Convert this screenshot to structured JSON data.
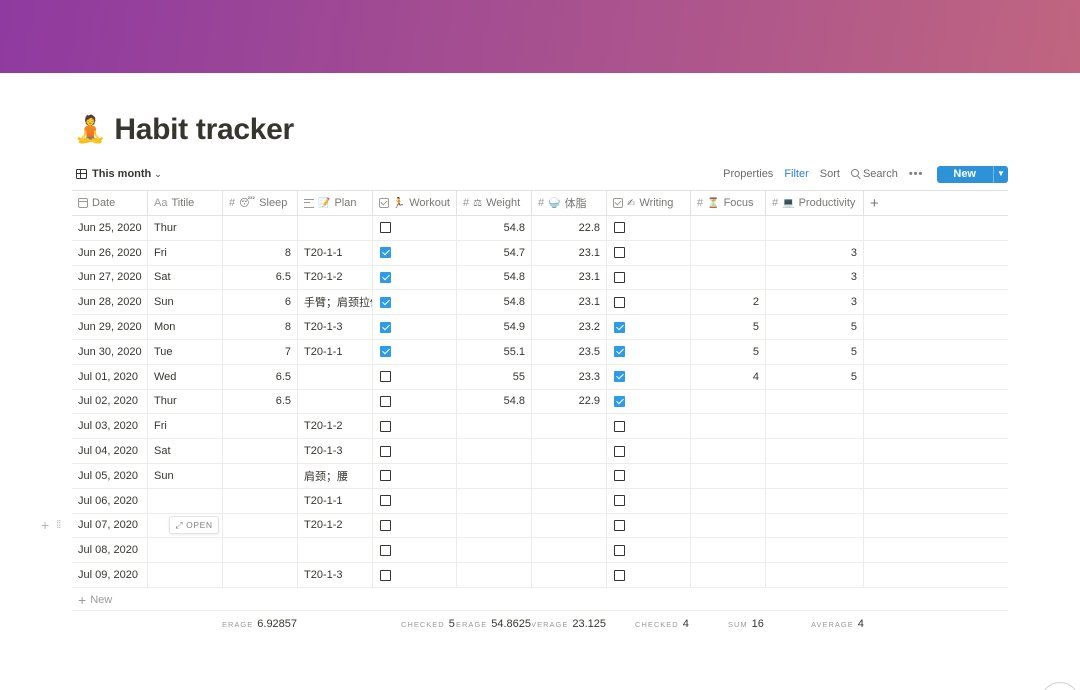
{
  "page": {
    "title_emoji": "🧘",
    "title": "Habit tracker",
    "cover_colors": [
      "#8f3aa0",
      "#c06580"
    ]
  },
  "toolbar": {
    "view_label": "This month",
    "properties": "Properties",
    "filter": "Filter",
    "sort": "Sort",
    "search": "Search",
    "more": "•••",
    "new": "New",
    "new_dropdown_icon": "chevron-down-icon"
  },
  "columns": [
    {
      "name": "Date",
      "icon": "calendar-icon"
    },
    {
      "name": "Titile",
      "icon": "Aa"
    },
    {
      "name": "Sleep",
      "icon": "#",
      "emoji": "😴"
    },
    {
      "name": "Plan",
      "icon": "text-lines-icon",
      "emoji": "📝"
    },
    {
      "name": "Workout",
      "icon": "checkbox-icon",
      "emoji": "🏃"
    },
    {
      "name": "Weight",
      "icon": "#",
      "emoji": "⚖"
    },
    {
      "name": "体脂",
      "icon": "#",
      "emoji": "🍚"
    },
    {
      "name": "Writing",
      "icon": "checkbox-icon",
      "emoji": "✍"
    },
    {
      "name": "Focus",
      "icon": "#",
      "emoji": "⏳"
    },
    {
      "name": "Productivity",
      "icon": "#",
      "emoji": "💻"
    }
  ],
  "rows": [
    {
      "date": "Jun 25, 2020",
      "title": "Thur",
      "sleep": "",
      "plan": "",
      "workout": false,
      "weight": "54.8",
      "fat": "22.8",
      "writing": false,
      "focus": "",
      "productivity": ""
    },
    {
      "date": "Jun 26, 2020",
      "title": "Fri",
      "sleep": "8",
      "plan": "T20-1-1",
      "workout": true,
      "weight": "54.7",
      "fat": "23.1",
      "writing": false,
      "focus": "",
      "productivity": "3"
    },
    {
      "date": "Jun 27, 2020",
      "title": "Sat",
      "sleep": "6.5",
      "plan": "T20-1-2",
      "workout": true,
      "weight": "54.8",
      "fat": "23.1",
      "writing": false,
      "focus": "",
      "productivity": "3"
    },
    {
      "date": "Jun 28, 2020",
      "title": "Sun",
      "sleep": "6",
      "plan": "手臂；肩颈拉伸",
      "workout": true,
      "weight": "54.8",
      "fat": "23.1",
      "writing": false,
      "focus": "2",
      "productivity": "3"
    },
    {
      "date": "Jun 29, 2020",
      "title": "Mon",
      "sleep": "8",
      "plan": "T20-1-3",
      "workout": true,
      "weight": "54.9",
      "fat": "23.2",
      "writing": true,
      "focus": "5",
      "productivity": "5"
    },
    {
      "date": "Jun 30, 2020",
      "title": "Tue",
      "sleep": "7",
      "plan": "T20-1-1",
      "workout": true,
      "weight": "55.1",
      "fat": "23.5",
      "writing": true,
      "focus": "5",
      "productivity": "5"
    },
    {
      "date": "Jul 01, 2020",
      "title": "Wed",
      "sleep": "6.5",
      "plan": "",
      "workout": false,
      "weight": "55",
      "fat": "23.3",
      "writing": true,
      "focus": "4",
      "productivity": "5"
    },
    {
      "date": "Jul 02, 2020",
      "title": "Thur",
      "sleep": "6.5",
      "plan": "",
      "workout": false,
      "weight": "54.8",
      "fat": "22.9",
      "writing": true,
      "focus": "",
      "productivity": ""
    },
    {
      "date": "Jul 03, 2020",
      "title": "Fri",
      "sleep": "",
      "plan": "T20-1-2",
      "workout": false,
      "weight": "",
      "fat": "",
      "writing": false,
      "focus": "",
      "productivity": ""
    },
    {
      "date": "Jul 04, 2020",
      "title": "Sat",
      "sleep": "",
      "plan": "T20-1-3",
      "workout": false,
      "weight": "",
      "fat": "",
      "writing": false,
      "focus": "",
      "productivity": ""
    },
    {
      "date": "Jul 05, 2020",
      "title": "Sun",
      "sleep": "",
      "plan": "肩颈；腰",
      "workout": false,
      "weight": "",
      "fat": "",
      "writing": false,
      "focus": "",
      "productivity": ""
    },
    {
      "date": "Jul 06, 2020",
      "title": "",
      "sleep": "",
      "plan": "T20-1-1",
      "workout": false,
      "weight": "",
      "fat": "",
      "writing": false,
      "focus": "",
      "productivity": ""
    },
    {
      "date": "Jul 07, 2020",
      "title": "",
      "sleep": "",
      "plan": "T20-1-2",
      "workout": false,
      "weight": "",
      "fat": "",
      "writing": false,
      "focus": "",
      "productivity": ""
    },
    {
      "date": "Jul 08, 2020",
      "title": "",
      "sleep": "",
      "plan": "",
      "workout": false,
      "weight": "",
      "fat": "",
      "writing": false,
      "focus": "",
      "productivity": ""
    },
    {
      "date": "Jul 09, 2020",
      "title": "",
      "sleep": "",
      "plan": "T20-1-3",
      "workout": false,
      "weight": "",
      "fat": "",
      "writing": false,
      "focus": "",
      "productivity": ""
    }
  ],
  "hover_row": {
    "open_label": "OPEN"
  },
  "new_row_label": "New",
  "footer": {
    "sleep": {
      "label": "ERAGE",
      "value": "6.92857"
    },
    "workout": {
      "label": "CHECKED",
      "value": "5"
    },
    "weight": {
      "label": "ERAGE",
      "value": "54.8625"
    },
    "fat": {
      "label": "AVERAGE",
      "value": "23.125"
    },
    "writing": {
      "label": "CHECKED",
      "value": "4"
    },
    "focus": {
      "label": "SUM",
      "value": "16"
    },
    "productivity": {
      "label": "AVERAGE",
      "value": "4"
    }
  },
  "colors": {
    "accent": "#2e92d8",
    "checkbox_on": "#2e9be6",
    "text": "#37352f"
  }
}
